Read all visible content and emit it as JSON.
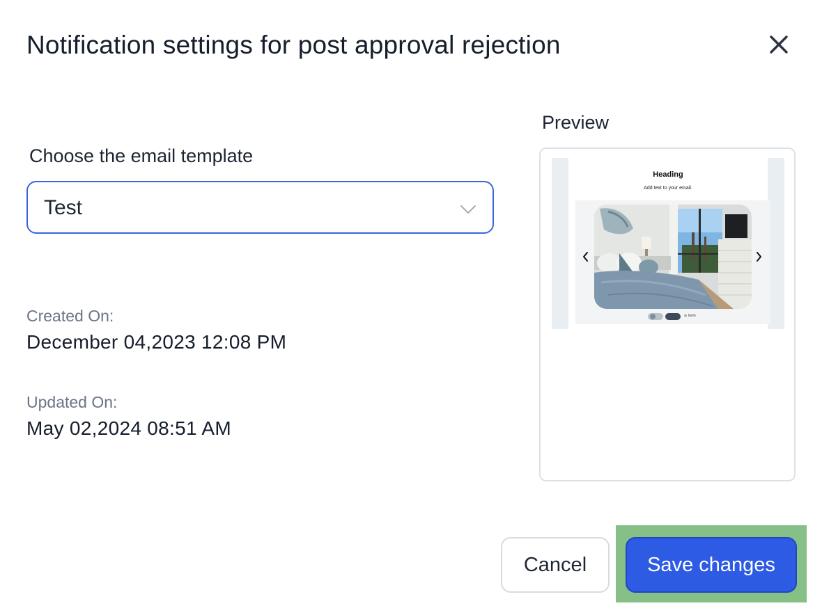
{
  "dialog": {
    "title": "Notification settings for post approval rejection",
    "close_icon": "close-icon"
  },
  "template": {
    "label": "Choose the email template",
    "selected": "Test",
    "dropdown_icon": "chevron-down-icon"
  },
  "meta": {
    "created_label": "Created On:",
    "created_value": "December 04,2023 12:08 PM",
    "updated_label": "Updated On:",
    "updated_value": "May 02,2024 08:51 AM"
  },
  "preview": {
    "label": "Preview",
    "email_heading": "Heading",
    "email_subtext": "Add text to your email.",
    "image": "bedroom-photo",
    "logo_text": "loom",
    "prev_icon": "chevron-left-icon",
    "next_icon": "chevron-right-icon"
  },
  "actions": {
    "cancel_label": "Cancel",
    "save_label": "Save changes"
  },
  "colors": {
    "accent": "#2d5be3",
    "select_border": "#3b64de",
    "highlight": "#86c087",
    "muted_text": "#6b7488"
  }
}
